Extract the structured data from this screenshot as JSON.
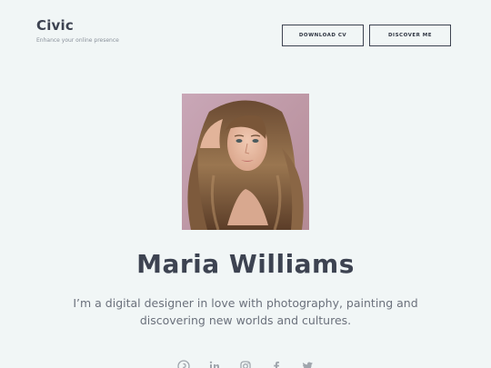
{
  "header": {
    "brand_title": "Civic",
    "brand_tagline": "Enhance your online presence",
    "download_cv_label": "DOWNLOAD CV",
    "discover_label": "DISCOVER ME"
  },
  "profile": {
    "portrait_alt": "Maria Williams portrait",
    "name": "Maria Williams",
    "bio": "I’m a digital designer in love with photography, painting and discovering new worlds and cultures."
  },
  "social": [
    {
      "icon": "pinterest-icon"
    },
    {
      "icon": "linkedin-icon"
    },
    {
      "icon": "instagram-icon"
    },
    {
      "icon": "facebook-icon"
    },
    {
      "icon": "twitter-icon"
    }
  ],
  "colors": {
    "background": "#f1f6f6",
    "text_dark": "#3d4351",
    "text_muted": "#6b717c",
    "icon": "#a0a6ad"
  }
}
